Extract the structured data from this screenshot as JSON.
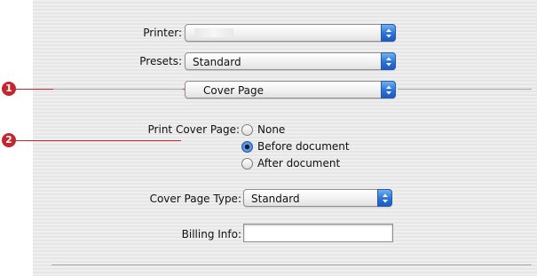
{
  "printer": {
    "label": "Printer:",
    "value": ""
  },
  "presets": {
    "label": "Presets:",
    "value": "Standard"
  },
  "panel_menu": {
    "value": "Cover Page"
  },
  "print_cover_page": {
    "label": "Print Cover Page:",
    "options": [
      "None",
      "Before document",
      "After document"
    ],
    "selected": "Before document"
  },
  "cover_page_type": {
    "label": "Cover Page Type:",
    "value": "Standard"
  },
  "billing_info": {
    "label": "Billing Info:",
    "value": ""
  },
  "callouts": {
    "one": "1",
    "two": "2",
    "color": "#c2272d"
  },
  "colors": {
    "accent": "#2b73d6"
  }
}
